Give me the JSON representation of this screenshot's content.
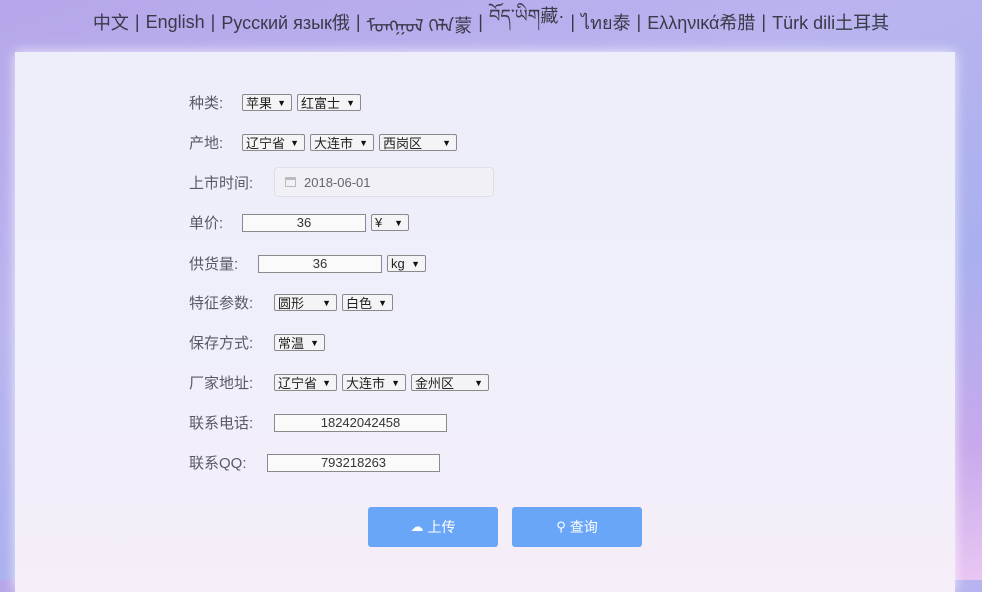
{
  "languages": [
    "中文",
    "English",
    "Русский язык俄",
    "ᠮᠣᠩᠭᠣᠯ ᠬᠡᠯᠡ蒙",
    "བོད་ཡིག藏·",
    "ไทย泰",
    "Ελληνικά希腊",
    "Türk dili土耳其"
  ],
  "separator": "|",
  "form": {
    "category": {
      "label": "种类:",
      "values": [
        "苹果",
        "红富士"
      ]
    },
    "origin": {
      "label": "产地:",
      "values": [
        "辽宁省",
        "大连市",
        "西岗区"
      ]
    },
    "market_time": {
      "label": "上市时间:",
      "value": "2018-06-01"
    },
    "unit_price": {
      "label": "单价:",
      "value": "36",
      "unit": "¥"
    },
    "supply": {
      "label": "供货量:",
      "value": "36",
      "unit": "kg"
    },
    "features": {
      "label": "特征参数:",
      "values": [
        "圆形",
        "白色"
      ]
    },
    "storage": {
      "label": "保存方式:",
      "value": "常温"
    },
    "factory_address": {
      "label": "厂家地址:",
      "values": [
        "辽宁省",
        "大连市",
        "金州区"
      ]
    },
    "phone": {
      "label": "联系电话:",
      "value": "18242042458"
    },
    "qq": {
      "label": "联系QQ:",
      "value": "793218263"
    }
  },
  "buttons": {
    "upload": "上传",
    "query": "查询"
  },
  "icons": {
    "upload": "cloud-upload-icon",
    "query": "search-icon",
    "calendar": "calendar-icon",
    "dropdown": "chevron-down-icon"
  }
}
